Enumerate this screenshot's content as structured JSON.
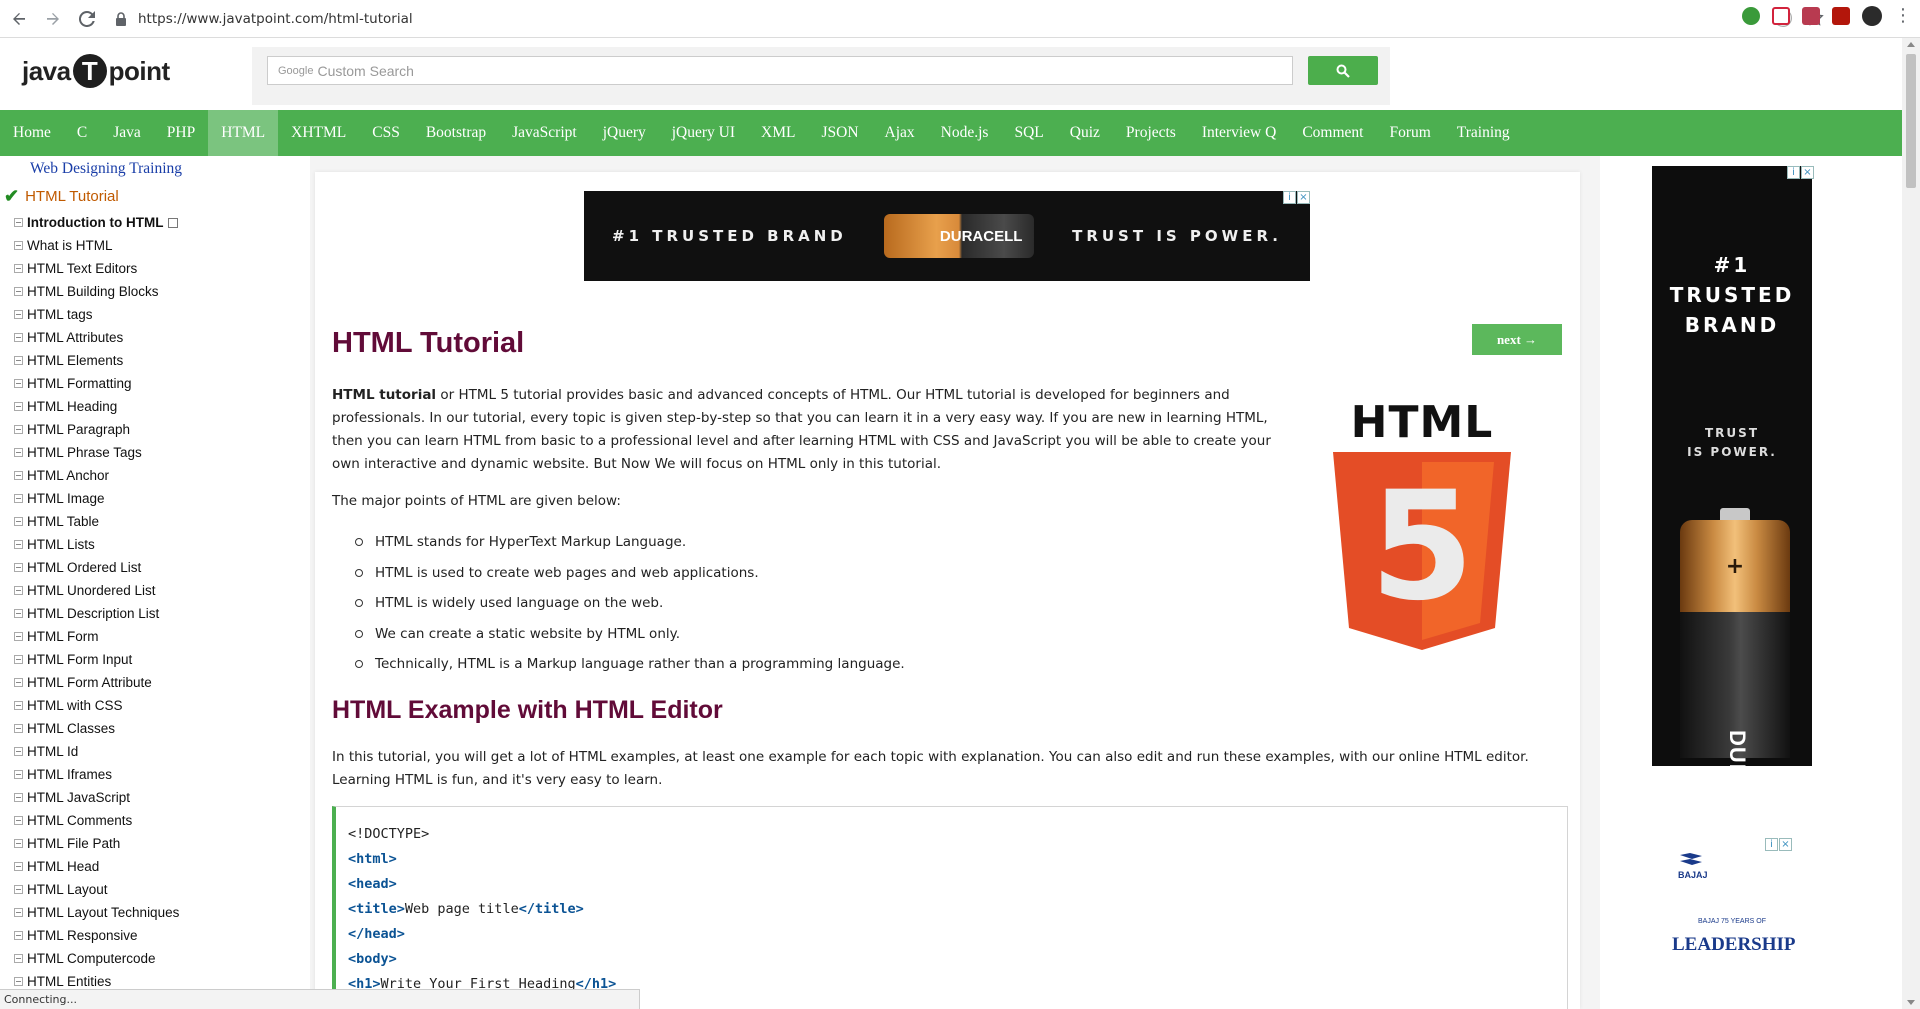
{
  "browser": {
    "url": "https://www.javatpoint.com/html-tutorial"
  },
  "logo": {
    "left": "java",
    "mid": "T",
    "right": "point"
  },
  "search": {
    "google": "Google",
    "placeholder": "Custom Search"
  },
  "nav": [
    "Home",
    "C",
    "Java",
    "PHP",
    "HTML",
    "XHTML",
    "CSS",
    "Bootstrap",
    "JavaScript",
    "jQuery",
    "jQuery UI",
    "XML",
    "JSON",
    "Ajax",
    "Node.js",
    "SQL",
    "Quiz",
    "Projects",
    "Interview Q",
    "Comment",
    "Forum",
    "Training"
  ],
  "nav_active": "HTML",
  "sidebar": {
    "training_link": "Web Designing Training",
    "current": "HTML Tutorial",
    "items": [
      "Introduction to HTML",
      "What is HTML",
      "HTML Text Editors",
      "HTML Building Blocks",
      "HTML tags",
      "HTML Attributes",
      "HTML Elements",
      "HTML Formatting",
      "HTML Heading",
      "HTML Paragraph",
      "HTML Phrase Tags",
      "HTML Anchor",
      "HTML Image",
      "HTML Table",
      "HTML Lists",
      "HTML Ordered List",
      "HTML Unordered List",
      "HTML Description List",
      "HTML Form",
      "HTML Form Input",
      "HTML Form Attribute",
      "HTML with CSS",
      "HTML Classes",
      "HTML Id",
      "HTML Iframes",
      "HTML JavaScript",
      "HTML Comments",
      "HTML File Path",
      "HTML Head",
      "HTML Layout",
      "HTML Layout Techniques",
      "HTML Responsive",
      "HTML Computercode",
      "HTML Entities"
    ]
  },
  "ad_top": {
    "left": "#1 TRUSTED BRAND",
    "brand": "DURACELL",
    "right": "TRUST IS POWER."
  },
  "main": {
    "title": "HTML Tutorial",
    "next": "next →",
    "intro_bold": "HTML tutorial",
    "intro_rest": " or HTML 5 tutorial provides basic and advanced concepts of HTML. Our HTML tutorial is developed for beginners and professionals. In our tutorial, every topic is given step-by-step so that you can learn it in a very easy way. If you are new in learning HTML, then you can learn HTML from basic to a professional level and after learning HTML with CSS and JavaScript you will be able to create your own interactive and dynamic website. But Now We will focus on HTML only in this tutorial.",
    "points_intro": "The major points of HTML are given below:",
    "points": [
      "HTML stands for HyperText Markup Language.",
      "HTML is used to create web pages and web applications.",
      "HTML is widely used language on the web.",
      "We can create a static website by HTML only.",
      "Technically, HTML is a Markup language rather than a programming language."
    ],
    "logo_text": "HTML",
    "logo_number": "5",
    "section_title": "HTML Example with HTML Editor",
    "section_text": "In this tutorial, you will get a lot of HTML examples, at least one example for each topic with explanation. You can also edit and run these examples, with our online HTML editor. Learning HTML is fun, and it's very easy to learn.",
    "code": {
      "l1": "<!DOCTYPE>",
      "l2": "<html>",
      "l3": "<head>",
      "l4_open": "<title>",
      "l4_text": "Web page title",
      "l4_close": "</title>",
      "l5": "</head>",
      "l6": "<body>",
      "l7_open": "<h1>",
      "l7_text": "Write Your First Heading",
      "l7_close": "</h1>"
    }
  },
  "ad_right": {
    "line1": "#1",
    "line2": "TRUSTED",
    "line3": "BRAND",
    "sub1": "TRUST",
    "sub2": "IS POWER.",
    "plus": "+",
    "brand": "DURACELL"
  },
  "ad_bajaj": {
    "brand_top": "BAJAJ",
    "years": "BAJAJ 75 YEARS OF",
    "leadership": "LEADERSHIP"
  },
  "status": "Connecting..."
}
